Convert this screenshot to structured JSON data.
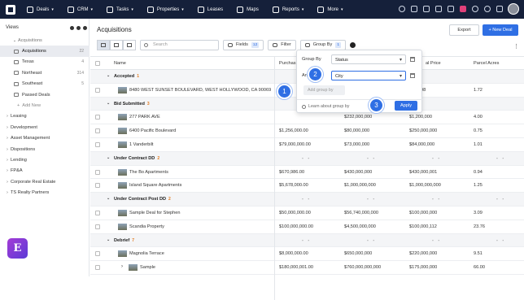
{
  "nav": {
    "items": [
      {
        "label": "Deals",
        "icon": "deals-icon"
      },
      {
        "label": "CRM",
        "icon": "crm-icon"
      },
      {
        "label": "Tasks",
        "icon": "tasks-icon"
      },
      {
        "label": "Properties",
        "icon": "properties-icon"
      },
      {
        "label": "Leases",
        "icon": "leases-icon"
      },
      {
        "label": "Maps",
        "icon": "maps-icon"
      },
      {
        "label": "Reports",
        "icon": "reports-icon"
      },
      {
        "label": "More",
        "icon": "more-icon"
      }
    ]
  },
  "sidebar": {
    "title": "Views",
    "items": [
      {
        "label": "Acquisitions",
        "level": "l1",
        "count": ""
      },
      {
        "label": "Acquisitions",
        "level": "l2",
        "count": "22"
      },
      {
        "label": "Texas",
        "level": "l2",
        "count": "4"
      },
      {
        "label": "Northeast",
        "level": "l2",
        "count": "314"
      },
      {
        "label": "Southeast",
        "level": "l2",
        "count": "5"
      },
      {
        "label": "Passed Deals",
        "level": "l2",
        "count": ""
      },
      {
        "label": "Add New",
        "level": "add",
        "count": ""
      },
      {
        "label": "Leasing",
        "level": "l0",
        "count": ""
      },
      {
        "label": "Development",
        "level": "l0",
        "count": ""
      },
      {
        "label": "Asset Management",
        "level": "l0",
        "count": ""
      },
      {
        "label": "Dispositions",
        "level": "l0",
        "count": ""
      },
      {
        "label": "Lending",
        "level": "l0",
        "count": ""
      },
      {
        "label": "FP&A",
        "level": "l0",
        "count": ""
      },
      {
        "label": "Corporate Real Estate",
        "level": "l0",
        "count": ""
      },
      {
        "label": "TS Realty Partners",
        "level": "l0",
        "count": ""
      }
    ]
  },
  "fab_letter": "E",
  "main": {
    "title": "Acquisitions",
    "export_label": "Export",
    "new_deal_label": "+ New Deal",
    "search_placeholder": "Search",
    "fields_label": "Fields",
    "fields_count": "12",
    "filter_label": "Filter",
    "groupby_label": "Group By",
    "groupby_count": "1"
  },
  "table": {
    "headers": {
      "name": "Name",
      "c1": "Purchas",
      "c3": "al Price",
      "c4": "Parcel Acres"
    },
    "rows": [
      {
        "type": "group",
        "name": "Accepted",
        "count": "1"
      },
      {
        "type": "deal",
        "name": "8480 WEST SUNSET BOULEVARD, WEST HOLLYWOOD, CA 90069",
        "c1": "",
        "c2": "",
        "c3": "199,998",
        "c4": "1.72"
      },
      {
        "type": "group",
        "name": "Bid Submitted",
        "count": "3"
      },
      {
        "type": "deal",
        "name": "277 PARK AVE",
        "c1": "",
        "c2": "$232,000,000",
        "c3": "$1,200,000",
        "c4": "4.00"
      },
      {
        "type": "deal",
        "name": "6400 Pacific Boulevard",
        "c1": "$1,256,000.00",
        "c2": "$80,000,000",
        "c3": "$250,000,000",
        "c4": "0.75"
      },
      {
        "type": "deal",
        "name": "1 Vanderbilt",
        "c1": "$79,000,000.00",
        "c2": "$73,000,000",
        "c3": "$84,000,000",
        "c4": "1.01"
      },
      {
        "type": "group",
        "name": "Under Contract DD",
        "count": "2",
        "dash": "- -"
      },
      {
        "type": "deal",
        "name": "The Bo Apartments",
        "c1": "$670,986.00",
        "c2": "$430,000,000",
        "c3": "$430,000,001",
        "c4": "0.94"
      },
      {
        "type": "deal",
        "name": "Island Square Apartments",
        "c1": "$5,678,000.00",
        "c2": "$1,000,000,000",
        "c3": "$1,000,000,000",
        "c4": "1.25"
      },
      {
        "type": "group",
        "name": "Under Contract Post DD",
        "count": "2",
        "dash": "- -"
      },
      {
        "type": "deal",
        "name": "Sample Deal for Stephen",
        "c1": "$50,000,000.00",
        "c2": "$56,740,000,000",
        "c3": "$100,000,000",
        "c4": "3.09"
      },
      {
        "type": "deal",
        "name": "Scandia Property",
        "c1": "$100,000,000.00",
        "c2": "$4,500,000,000",
        "c3": "$100,000,112",
        "c4": "23.76"
      },
      {
        "type": "group",
        "name": "Debrief",
        "count": "7",
        "dash": "- -"
      },
      {
        "type": "deal",
        "name": "Magnolia Terrace",
        "c1": "$8,000,000.00",
        "c2": "$650,000,000",
        "c3": "$220,000,000",
        "c4": "9.51"
      },
      {
        "type": "sub",
        "name": "Sample",
        "c1": "$180,000,001.00",
        "c2": "$760,000,000,000",
        "c3": "$175,000,000",
        "c4": "66.00"
      }
    ]
  },
  "popup": {
    "group_by_label": "Group By",
    "group_by_value": "Status",
    "and_label": "An",
    "and_value": "City",
    "add_group_label": "Add group by",
    "learn_label": "Learn about group by",
    "apply_label": "Apply"
  },
  "steps": [
    "1",
    "2",
    "3"
  ]
}
